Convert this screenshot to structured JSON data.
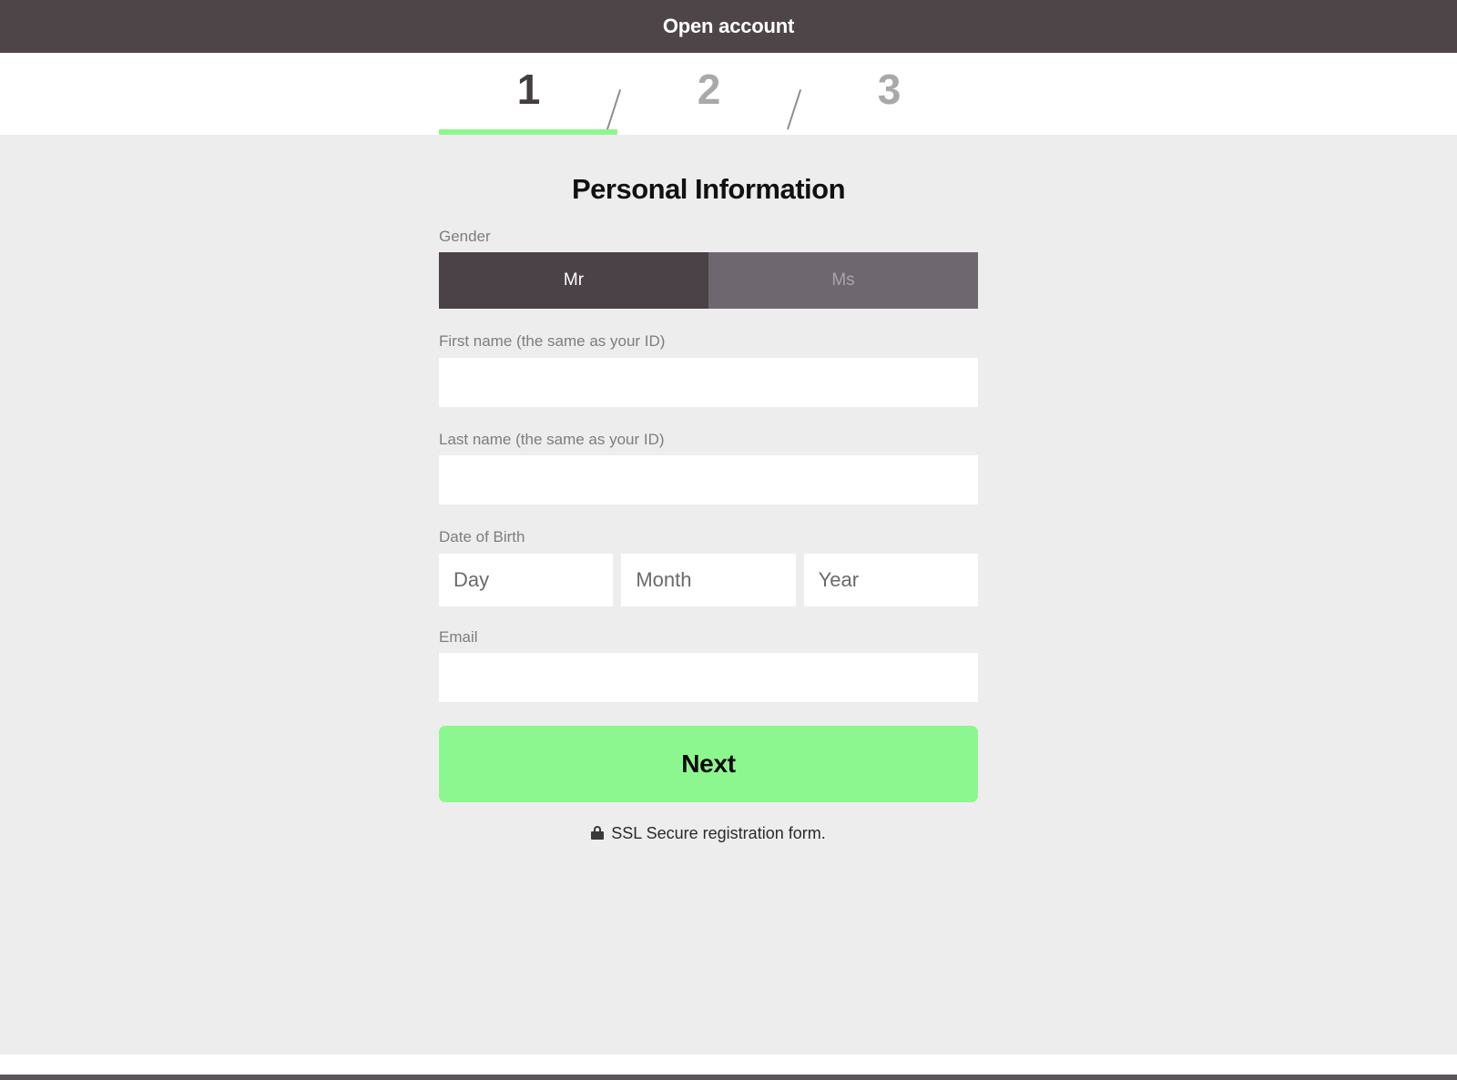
{
  "titlebar": {
    "title": "Open account"
  },
  "stepper": {
    "steps": [
      {
        "label": "1",
        "active": true
      },
      {
        "label": "2",
        "active": false
      },
      {
        "label": "3",
        "active": false
      }
    ],
    "separator": "/",
    "active_color": "#8df78f"
  },
  "form": {
    "heading": "Personal Information",
    "gender": {
      "label": "Gender",
      "options": [
        {
          "label": "Mr",
          "selected": true
        },
        {
          "label": "Ms",
          "selected": false
        }
      ]
    },
    "first_name": {
      "label": "First name (the same as your ID)",
      "value": "",
      "placeholder": ""
    },
    "last_name": {
      "label": "Last name (the same as your ID)",
      "value": "",
      "placeholder": ""
    },
    "date_of_birth": {
      "label": "Date of Birth",
      "day": {
        "value": "",
        "placeholder": "Day"
      },
      "month": {
        "value": "",
        "placeholder": "Month"
      },
      "year": {
        "value": "",
        "placeholder": "Year"
      }
    },
    "email": {
      "label": "Email",
      "value": "",
      "placeholder": ""
    },
    "submit": {
      "label": "Next"
    },
    "ssl_note": {
      "icon": "lock-icon",
      "text": "SSL Secure registration form."
    }
  },
  "colors": {
    "titlebar": "#4e4549",
    "accent_green": "#8df78f",
    "content_bg": "#ededed",
    "gender_selected": "#4a4247",
    "gender_unselected": "#6e6770"
  }
}
